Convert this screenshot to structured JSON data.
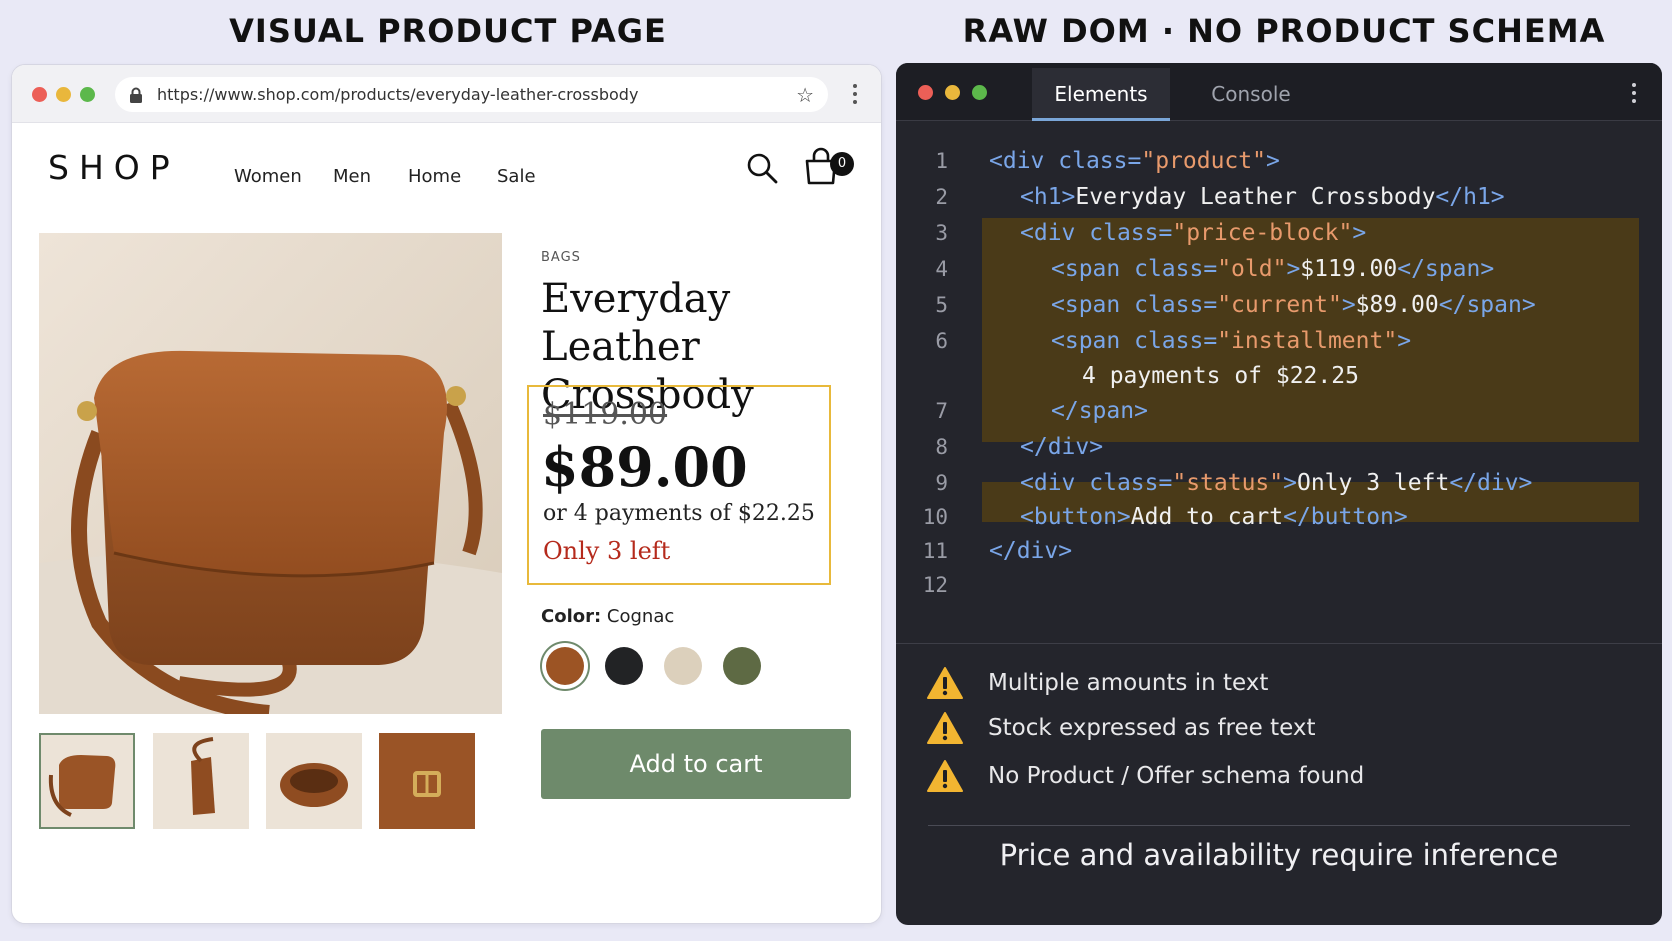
{
  "headings": {
    "left": "VISUAL PRODUCT PAGE",
    "right": "RAW DOM · NO PRODUCT SCHEMA"
  },
  "browser": {
    "url": "https://www.shop.com/products/everyday-leather-crossbody"
  },
  "store": {
    "logo": "SHOP",
    "nav": [
      "Women",
      "Men",
      "Home",
      "Sale"
    ],
    "cart_count": "0"
  },
  "product": {
    "category": "BAGS",
    "title": "Everyday Leather Crossbody",
    "old_price": "$119.00",
    "price": "$89.00",
    "installment": "or 4 payments of $22.25",
    "stock": "Only 3 left",
    "color_label": "Color:",
    "color_value": "Cognac",
    "swatches": [
      "#9c5424",
      "#222325",
      "#dcd0bc",
      "#5e6a44"
    ],
    "add_to_cart": "Add to cart"
  },
  "devtools": {
    "tabs": [
      "Elements",
      "Console"
    ],
    "line_numbers": [
      "1",
      "2",
      "3",
      "4",
      "5",
      "6",
      "7",
      "8",
      "9",
      "10",
      "11",
      "12"
    ],
    "code": {
      "l1": {
        "open": "<div ",
        "attr": "class=",
        "val": "\"product\"",
        "close": ">"
      },
      "l2": {
        "open": "<h1>",
        "text": "Everyday Leather Crossbody",
        "close": "</h1>"
      },
      "l3": {
        "open": "<div ",
        "attr": "class=",
        "val": "\"price-block\"",
        "close": ">"
      },
      "l4": {
        "open": "<span ",
        "attr": "class=",
        "val": "\"old\"",
        "gt": ">",
        "text": "$119.00",
        "close": "</span>"
      },
      "l5": {
        "open": "<span ",
        "attr": "class=",
        "val": "\"current\"",
        "gt": ">",
        "text": "$89.00",
        "close": "</span>"
      },
      "l6": {
        "open": "<span ",
        "attr": "class=",
        "val": "\"installment\"",
        "close": ">"
      },
      "l6b": {
        "text": "4 payments of $22.25"
      },
      "l7": {
        "close": "</span>"
      },
      "l8": {
        "close": "</div>"
      },
      "l9": {
        "open": "<div ",
        "attr": "class=",
        "val": "\"status\"",
        "gt": ">",
        "text": "Only 3 left",
        "close": "</div>"
      },
      "l10": {
        "open": "<button>",
        "text": "Add to cart",
        "close": "</button>"
      },
      "l11": {
        "close": "</div>"
      }
    },
    "warnings": [
      "Multiple amounts in  text",
      "Stock expressed as free text",
      "No Product / Offer schema found"
    ],
    "conclusion": "Price and availability require inference"
  }
}
